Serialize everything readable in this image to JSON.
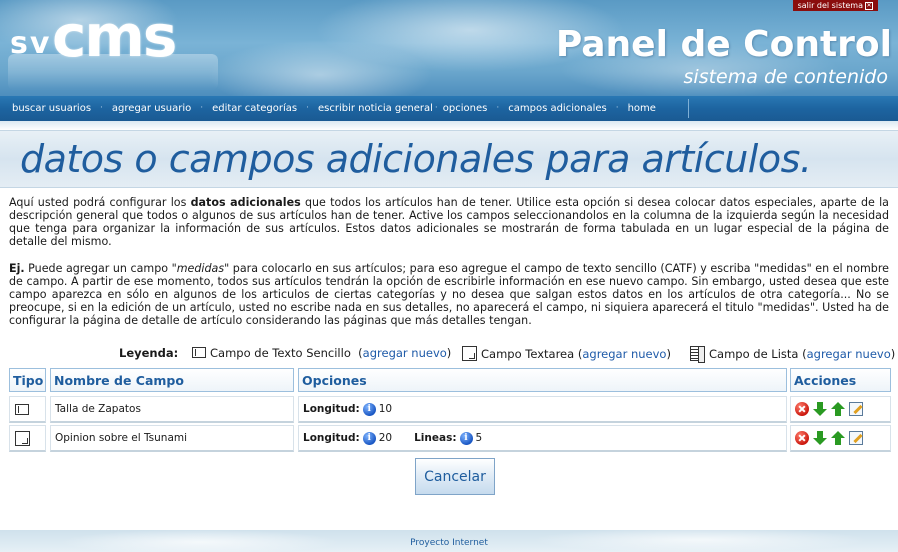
{
  "header": {
    "logo_prefix": "sv",
    "logo_main": "cms",
    "title": "Panel de Control",
    "subtitle": "sistema de contenido",
    "exit_label": "salir del sistema"
  },
  "nav": {
    "items": [
      {
        "label": "buscar usuarios"
      },
      {
        "label": "agregar usuario"
      },
      {
        "label": "editar categorías"
      },
      {
        "label": "escribir noticia general"
      },
      {
        "label": "opciones"
      },
      {
        "label": "campos adicionales"
      },
      {
        "label": "home"
      }
    ],
    "separator": "·"
  },
  "page": {
    "title": "datos o campos adicionales para artículos."
  },
  "description": {
    "p1_a": "Aquí usted podrá configurar los ",
    "p1_bold": "datos adicionales",
    "p1_b": " que todos los artículos han de tener. Utilice esta opción si desea colocar datos especiales, aparte de la descripción general que  todos o algunos de sus artículos han de tener. Active los campos seleccionandolos en la columna de la izquierda según la necesidad que tenga para organizar la información de sus artículos. Estos datos adicionales se mostrarán de forma tabulada en un lugar especial de la página de detalle del mismo.",
    "p2_bold": "Ej.",
    "p2_a": " Puede agregar un campo \"",
    "p2_italic": "medidas",
    "p2_b": "\" para colocarlo en sus artículos; para eso agregue el campo de texto sencillo (CATF) y escriba \"medidas\" en el nombre de campo. A partir de ese momento, todos sus artículos tendrán la opción de escribirle información en ese nuevo campo. Sin embargo, usted desea que este campo aparezca en sólo en  algunos de los articulos de ciertas categorías y no desea que salgan estos datos en los artículos de otra categoría...  No se preocupe, si en la edición de un artículo, usted no escribe nada en sus detalles, no aparecerá el campo, ni siquiera aparecerá el titulo \"medidas\". Usted ha de configurar la página de detalle de artículo considerando las páginas que más detalles tengan."
  },
  "legend": {
    "label": "Leyenda:",
    "items": [
      {
        "name": "Campo de Texto Sencillo",
        "link": "agregar nuevo"
      },
      {
        "name": "Campo Textarea",
        "link": "agregar nuevo"
      },
      {
        "name": "Campo de Lista",
        "link": "agregar nuevo"
      }
    ]
  },
  "table": {
    "headers": {
      "type": "Tipo",
      "name": "Nombre de Campo",
      "options": "Opciones",
      "actions": "Acciones"
    },
    "rows": [
      {
        "type_icon": "textfield-icon",
        "name": "Talla de Zapatos",
        "opt1_label": "Longitud:",
        "opt1_value": "10",
        "opt2_label": "",
        "opt2_value": ""
      },
      {
        "type_icon": "textarea-icon",
        "name": "Opinion sobre el Tsunami",
        "opt1_label": "Longitud:",
        "opt1_value": "20",
        "opt2_label": "Lineas:",
        "opt2_value": "5"
      }
    ]
  },
  "cancel_label": "Cancelar",
  "footer": {
    "text": "Proyecto Internet"
  },
  "colors": {
    "accent": "#1f5d9e",
    "nav": "#1d64a0",
    "exit": "#8a0d0d"
  }
}
